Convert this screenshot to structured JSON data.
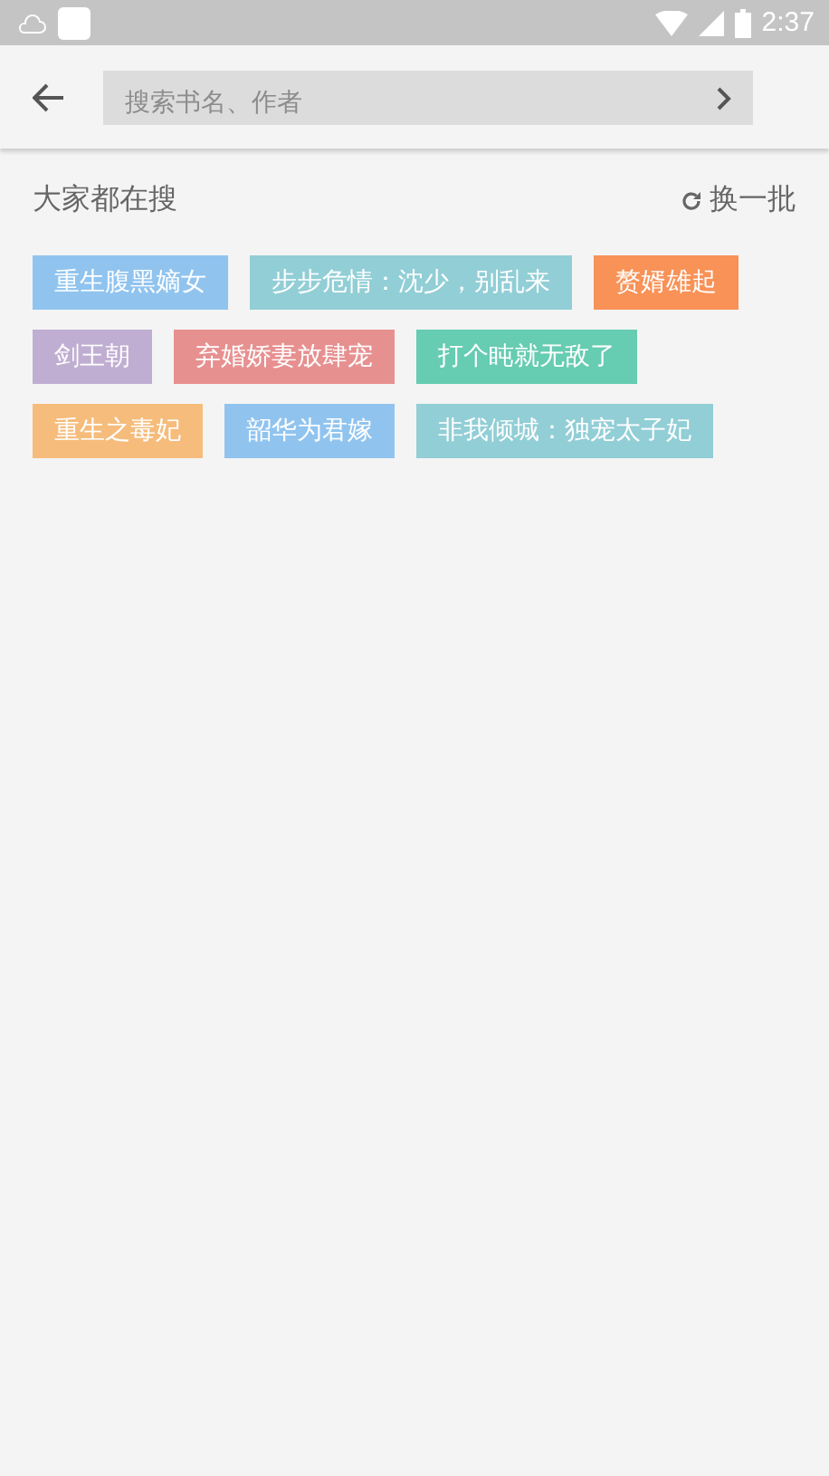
{
  "status_bar": {
    "time": "2:37"
  },
  "search": {
    "placeholder": "搜索书名、作者"
  },
  "section": {
    "title": "大家都在搜",
    "refresh_label": "换一批"
  },
  "tags": [
    {
      "label": "重生腹黑嫡女",
      "color": "#90c4ef"
    },
    {
      "label": "步步危情：沈少，别乱来",
      "color": "#92ced6"
    },
    {
      "label": "赘婿雄起",
      "color": "#f89257"
    },
    {
      "label": "剑王朝",
      "color": "#c0aed2"
    },
    {
      "label": "弃婚娇妻放肆宠",
      "color": "#e79090"
    },
    {
      "label": "打个盹就无敌了",
      "color": "#66ccb2"
    },
    {
      "label": "重生之毒妃",
      "color": "#f6bc7c"
    },
    {
      "label": "韶华为君嫁",
      "color": "#90c4ef"
    },
    {
      "label": "非我倾城：独宠太子妃",
      "color": "#92ced6"
    }
  ]
}
